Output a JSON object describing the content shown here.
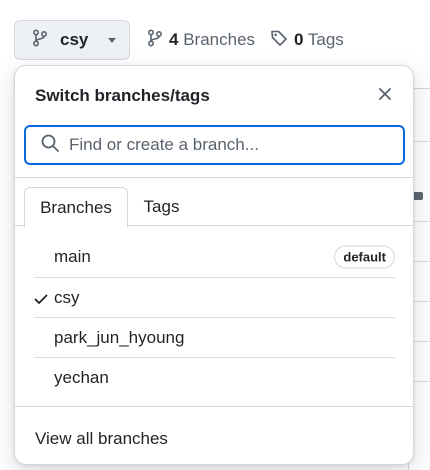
{
  "toolbar": {
    "branch_button_label": "csy",
    "branches_count": "4",
    "branches_label": "Branches",
    "tags_count": "0",
    "tags_label": "Tags"
  },
  "dropdown": {
    "title": "Switch branches/tags",
    "search_placeholder": "Find or create a branch...",
    "tabs": [
      {
        "label": "Branches",
        "active": true
      },
      {
        "label": "Tags",
        "active": false
      }
    ],
    "branches": [
      {
        "name": "main",
        "badge": "default",
        "selected": false
      },
      {
        "name": "csy",
        "badge": "",
        "selected": true
      },
      {
        "name": "park_jun_hyoung",
        "badge": "",
        "selected": false
      },
      {
        "name": "yechan",
        "badge": "",
        "selected": false
      }
    ],
    "footer_link": "View all branches"
  },
  "colors": {
    "accent": "#0969da",
    "text": "#1f2328",
    "muted": "#59636e",
    "border": "#d1d9e0",
    "button_bg": "#eef1f4"
  },
  "icons": {
    "branch": "git-branch-icon",
    "tag": "tag-icon",
    "close": "x-icon",
    "search": "search-icon",
    "check": "check-icon",
    "caret": "triangle-down-icon"
  }
}
